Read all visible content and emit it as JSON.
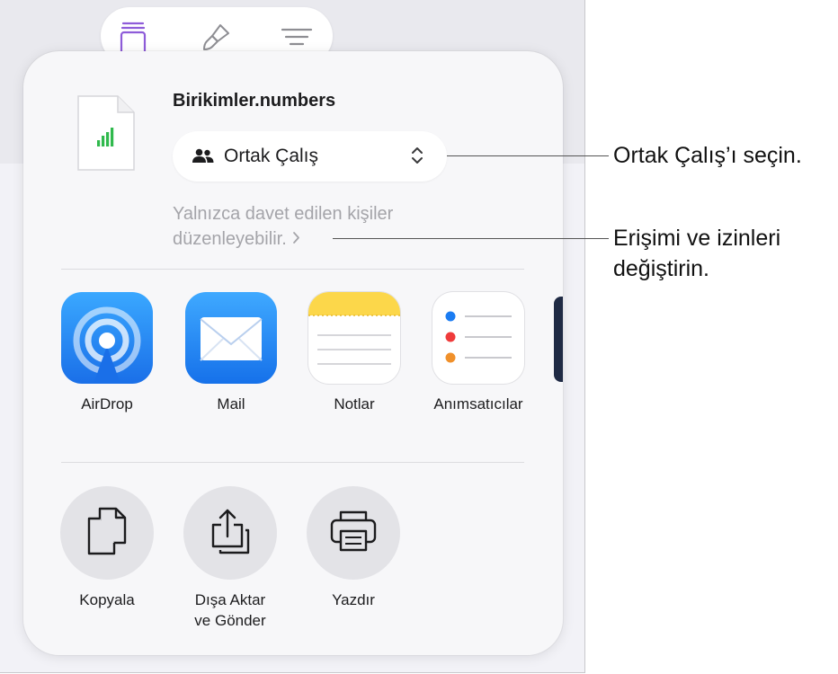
{
  "document": {
    "title": "Birikimler.numbers"
  },
  "collaboration": {
    "mode_label": "Ortak Çalış",
    "permission_line1": "Yalnızca davet edilen kişiler",
    "permission_line2": "düzenleyebilir."
  },
  "apps": [
    {
      "label": "AirDrop",
      "icon": "airdrop-icon"
    },
    {
      "label": "Mail",
      "icon": "mail-icon"
    },
    {
      "label": "Notlar",
      "icon": "notes-icon"
    },
    {
      "label": "Anımsatıcılar",
      "icon": "reminders-icon"
    }
  ],
  "actions": [
    {
      "label_line1": "Kopyala",
      "label_line2": "",
      "icon": "copy-icon"
    },
    {
      "label_line1": "Dışa Aktar",
      "label_line2": "ve Gönder",
      "icon": "export-icon"
    },
    {
      "label_line1": "Yazdır",
      "label_line2": "",
      "icon": "print-icon"
    }
  ],
  "callouts": {
    "collaborate": "Ortak Çalış’ı seçin.",
    "access_line1": "Erişimi ve izinleri",
    "access_line2": "değiştirin."
  },
  "colors": {
    "accent_purple": "#8e5cd9",
    "numbers_green": "#30b94d",
    "airdrop_blue": "#1a7ff0",
    "mail_blue": "#1e86f5",
    "notes_yellow": "#fcd74a"
  }
}
